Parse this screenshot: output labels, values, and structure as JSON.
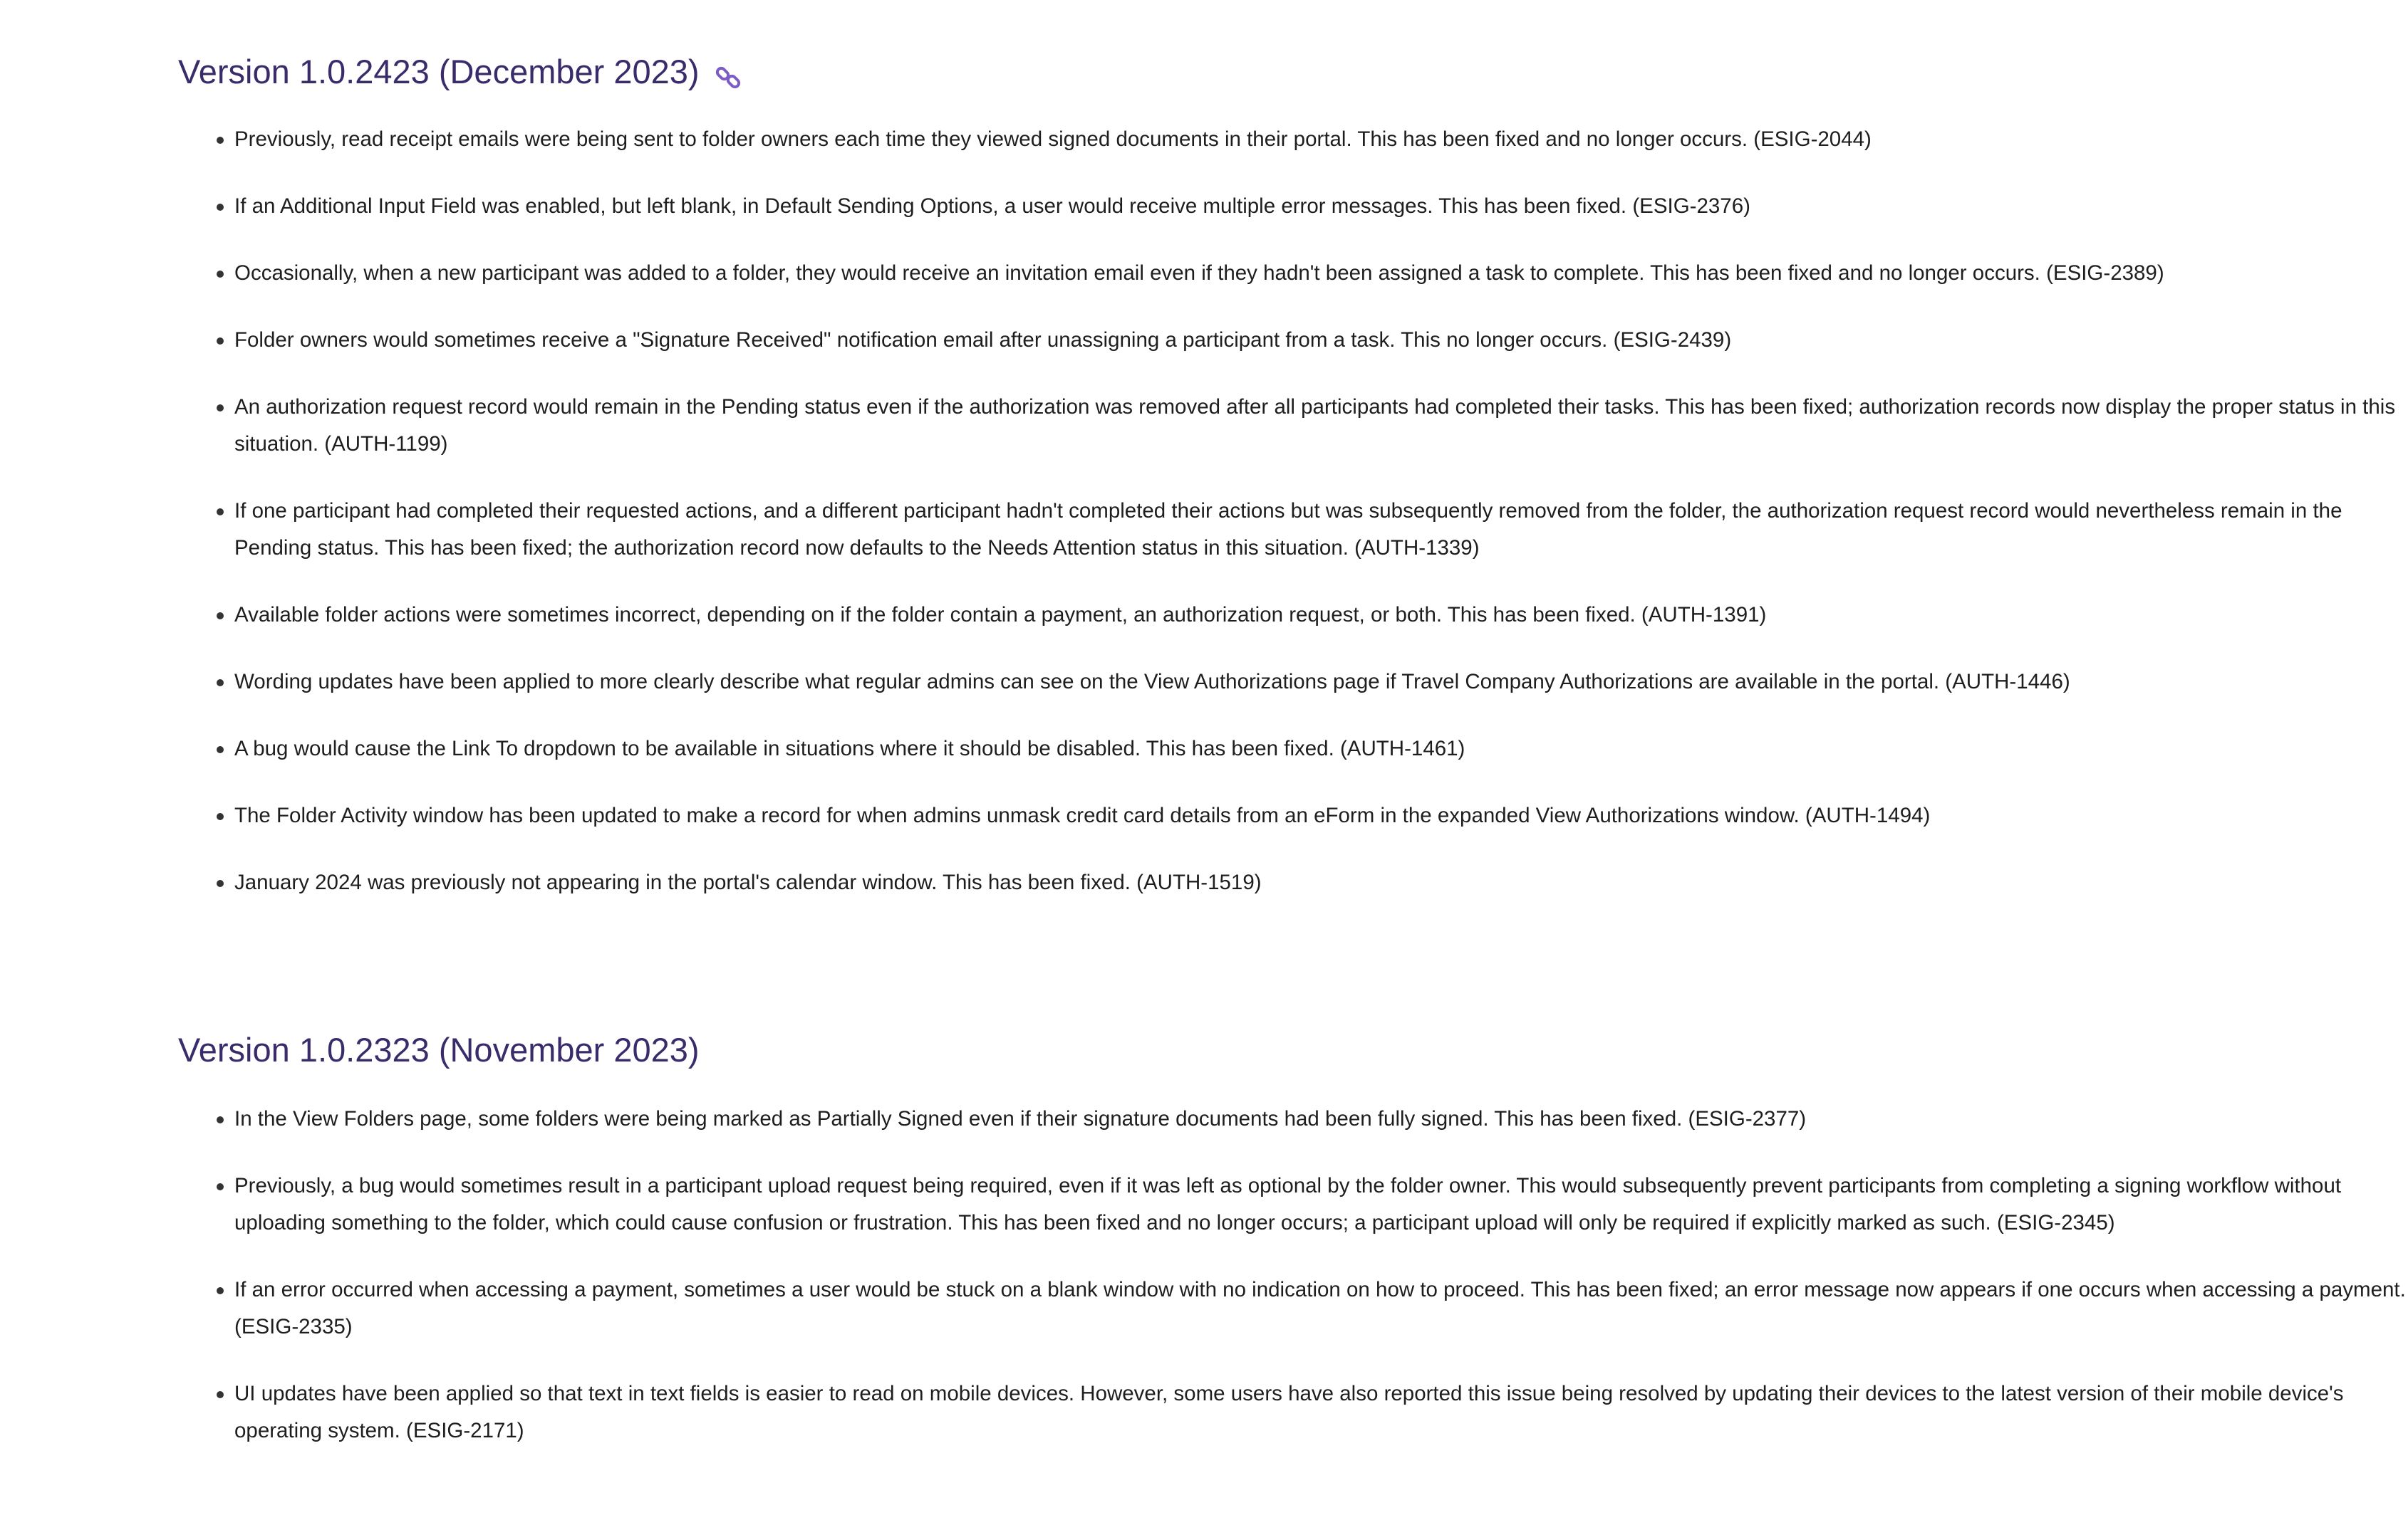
{
  "sections": [
    {
      "heading": "Version 1.0.2423 (December 2023)",
      "has_link_icon": true,
      "link_icon": "link-icon",
      "items": [
        "Previously, read receipt emails were being sent to folder owners each time they viewed signed documents in their portal. This has been fixed and no longer occurs. (ESIG-2044)",
        "If an Additional Input Field was enabled, but left blank, in Default Sending Options, a user would receive multiple error messages. This has been fixed. (ESIG-2376)",
        "Occasionally, when a new participant was added to a folder, they would receive an invitation email even if they hadn't been assigned a task to complete. This has been fixed and no longer occurs. (ESIG-2389)",
        "Folder owners would sometimes receive a \"Signature Received\" notification email after unassigning a participant from a task. This no longer occurs. (ESIG-2439)",
        "An authorization request record would remain in the Pending status even if the authorization was removed after all participants had completed their tasks. This has been fixed; authorization records now display the proper status in this situation. (AUTH-1199)",
        "If one participant had completed their requested actions, and a different participant hadn't completed their actions but was subsequently removed from the folder, the authorization request record would nevertheless remain in the Pending status. This has been fixed; the authorization record now defaults to the Needs Attention status in this situation. (AUTH-1339)",
        "Available folder actions were sometimes incorrect, depending on if the folder contain a payment, an authorization request, or both. This has been fixed. (AUTH-1391)",
        "Wording updates have been applied to more clearly describe what regular admins can see on the View Authorizations page if Travel Company Authorizations are available in the portal. (AUTH-1446)",
        "A bug would cause the Link To dropdown to be available in situations where it should be disabled. This has been fixed. (AUTH-1461)",
        "The Folder Activity window has been updated to make a record for when admins unmask credit card details from an eForm in the expanded View Authorizations window. (AUTH-1494)",
        "January 2024 was previously not appearing in the portal's calendar window. This has been fixed. (AUTH-1519)"
      ]
    },
    {
      "heading": "Version 1.0.2323 (November 2023)",
      "has_link_icon": false,
      "items": [
        "In the View Folders page, some folders were being marked as Partially Signed even if their signature documents had been fully signed. This has been fixed. (ESIG-2377)",
        "Previously, a bug would sometimes result in a participant upload request being required, even if it was left as optional by the folder owner. This would subsequently prevent participants from completing a signing workflow without uploading something to the folder, which could cause confusion or frustration. This has been fixed and no longer occurs; a participant upload will only be required if explicitly marked as such. (ESIG-2345)",
        "If an error occurred when accessing a payment, sometimes a user would be stuck on a blank window with no indication on how to proceed. This has been fixed; an error message now appears if one occurs when accessing a payment. (ESIG-2335)",
        "UI updates have been applied so that text in text fields is easier to read on mobile devices. However, some users have also reported this issue being resolved by updating their devices to the latest version of their mobile device's operating system. (ESIG-2171)"
      ]
    }
  ],
  "colors": {
    "heading": "#3a2c6b",
    "link_icon": "#7b5cc4",
    "body_text": "#1e1e1e"
  }
}
